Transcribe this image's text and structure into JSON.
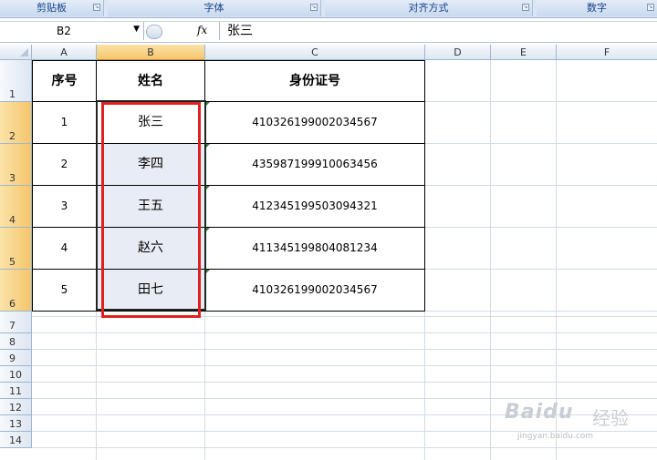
{
  "ribbon": {
    "groups": [
      "剪贴板",
      "字体",
      "对齐方式",
      "数字"
    ]
  },
  "formula_bar": {
    "name_box": "B2",
    "fx_label": "fx",
    "value": "张三"
  },
  "grid": {
    "columns": [
      "A",
      "B",
      "C",
      "D",
      "E",
      "F"
    ],
    "rows": [
      "1",
      "2",
      "3",
      "4",
      "5",
      "6",
      "7",
      "8",
      "9",
      "10",
      "11",
      "12",
      "13",
      "14"
    ],
    "table": {
      "headers": [
        "序号",
        "姓名",
        "身份证号"
      ],
      "rows": [
        [
          "1",
          "张三",
          "410326199002034567"
        ],
        [
          "2",
          "李四",
          "435987199910063456"
        ],
        [
          "3",
          "王五",
          "412345199503094321"
        ],
        [
          "4",
          "赵六",
          "411345199804081234"
        ],
        [
          "5",
          "田七",
          "410326199002034567"
        ]
      ]
    }
  },
  "watermark": {
    "brand": "Baidu",
    "zh": "经验",
    "sub": "jingyan.baidu.com"
  },
  "colors": {
    "selection_header": "#f5c56b",
    "highlight_box": "#e02020",
    "ribbon_text": "#15428b"
  }
}
